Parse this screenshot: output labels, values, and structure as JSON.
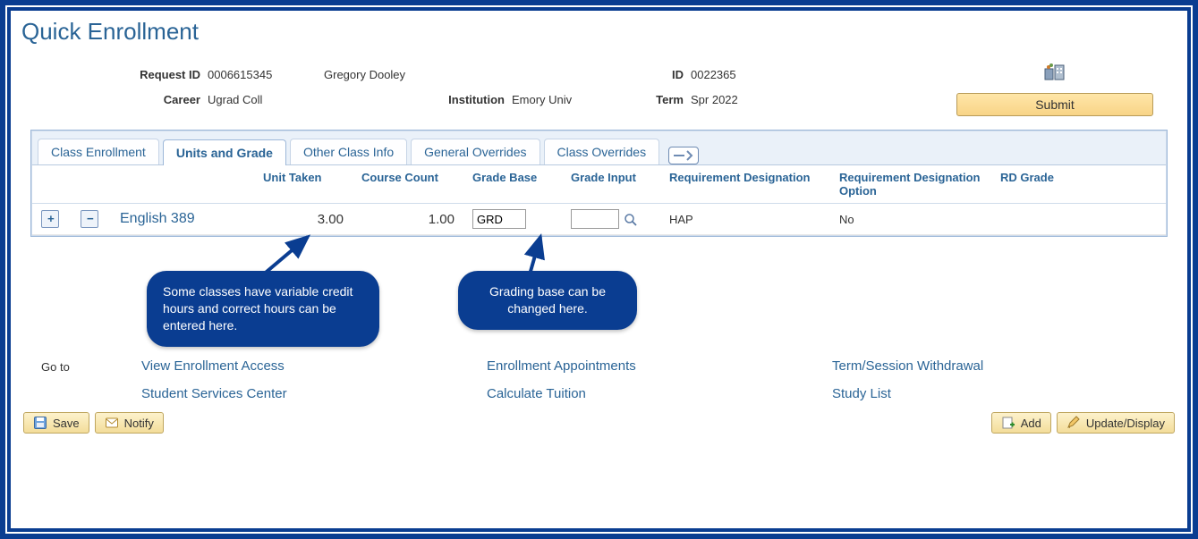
{
  "page_title": "Quick Enrollment",
  "header": {
    "request_id_label": "Request ID",
    "request_id": "0006615345",
    "student_name": "Gregory Dooley",
    "id_label": "ID",
    "id": "0022365",
    "career_label": "Career",
    "career": "Ugrad Coll",
    "institution_label": "Institution",
    "institution": "Emory Univ",
    "term_label": "Term",
    "term": "Spr 2022",
    "submit_label": "Submit"
  },
  "tabs": {
    "class_enrollment": "Class Enrollment",
    "units_and_grade": "Units and Grade",
    "other_class_info": "Other Class Info",
    "general_overrides": "General Overrides",
    "class_overrides": "Class Overrides"
  },
  "grid": {
    "columns": {
      "unit_taken": "Unit Taken",
      "course_count": "Course Count",
      "grade_base": "Grade Base",
      "grade_input": "Grade Input",
      "req_desig": "Requirement Designation",
      "req_desig_opt": "Requirement Designation Option",
      "rd_grade": "RD Grade"
    },
    "row": {
      "course": "English 389",
      "unit_taken": "3.00",
      "course_count": "1.00",
      "grade_base": "GRD",
      "grade_input": "",
      "req_desig": "HAP",
      "req_desig_opt": "No",
      "rd_grade": ""
    }
  },
  "callouts": {
    "left": "Some classes have variable credit hours and correct hours can be entered here.",
    "right": "Grading base can be changed here."
  },
  "goto": {
    "label": "Go to",
    "col1": {
      "a": "View Enrollment Access",
      "b": "Student Services Center"
    },
    "col2": {
      "a": "Enrollment Appointments",
      "b": "Calculate Tuition"
    },
    "col3": {
      "a": "Term/Session Withdrawal",
      "b": "Study List"
    }
  },
  "footer": {
    "save": "Save",
    "notify": "Notify",
    "add": "Add",
    "update": "Update/Display"
  }
}
